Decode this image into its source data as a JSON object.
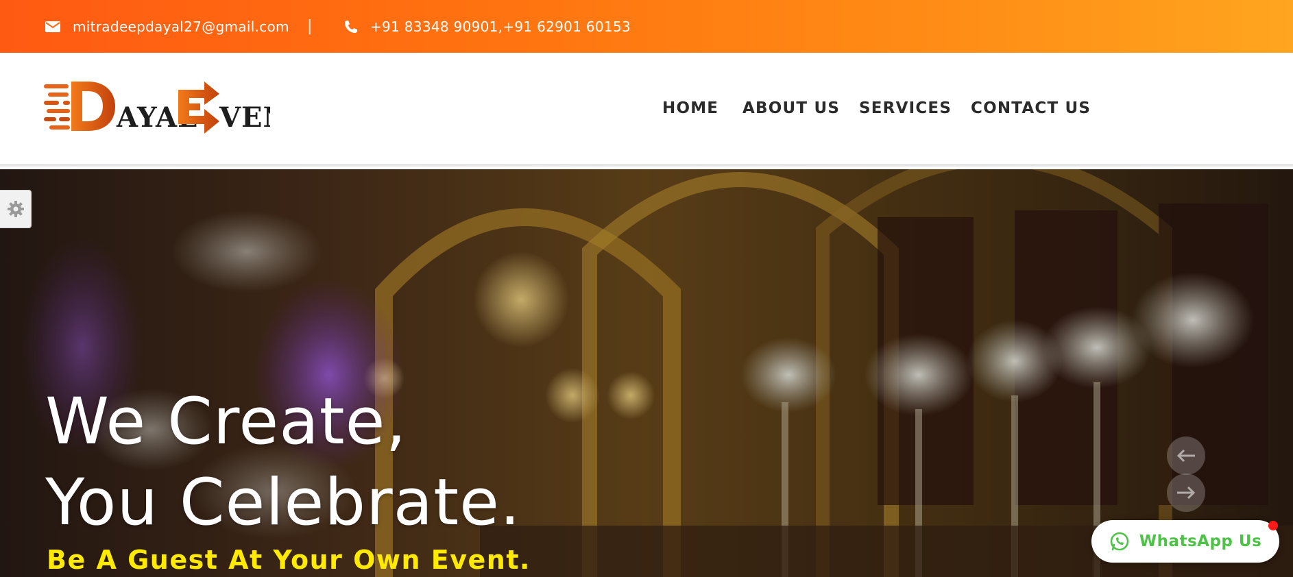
{
  "topbar": {
    "email": "mitradeepdayal27@gmail.com",
    "separator": "|",
    "phone": "+91 83348 90901,+91 62901 60153",
    "email_icon": "envelope-icon",
    "phone_icon": "phone-icon"
  },
  "header": {
    "logo": {
      "text_d": "D",
      "text_ayal": "AYAL",
      "text_e": "E",
      "text_vent": "VENT"
    },
    "nav": [
      {
        "label": "HOME"
      },
      {
        "label": "ABOUT US"
      },
      {
        "label": "SERVICES"
      },
      {
        "label": "CONTACT US"
      }
    ]
  },
  "hero": {
    "title_line1": "We Create,",
    "title_line2": "You Celebrate.",
    "subtitle": "Be A Guest At Your Own Event.",
    "prev_icon": "arrow-left-icon",
    "next_icon": "arrow-right-icon",
    "settings_icon": "gear-icon"
  },
  "whatsapp": {
    "label": "WhatsApp Us",
    "icon": "whatsapp-icon"
  },
  "colors": {
    "topbar_start": "#ff5a12",
    "topbar_end": "#ffa51f",
    "nav_text": "#2b2b2b",
    "hero_subtitle": "#ffea00",
    "whatsapp_green": "#4dc247",
    "notification_dot": "#ff1a1a"
  }
}
